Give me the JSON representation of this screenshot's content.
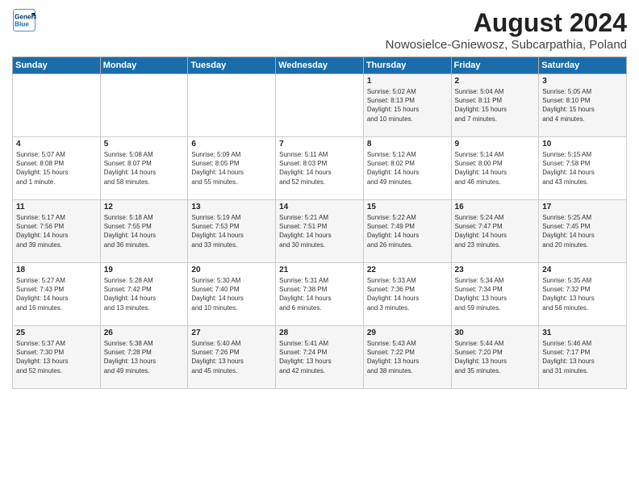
{
  "logo": {
    "line1": "General",
    "line2": "Blue"
  },
  "title": "August 2024",
  "subtitle": "Nowosielce-Gniewosz, Subcarpathia, Poland",
  "days_of_week": [
    "Sunday",
    "Monday",
    "Tuesday",
    "Wednesday",
    "Thursday",
    "Friday",
    "Saturday"
  ],
  "weeks": [
    [
      {
        "day": "",
        "info": ""
      },
      {
        "day": "",
        "info": ""
      },
      {
        "day": "",
        "info": ""
      },
      {
        "day": "",
        "info": ""
      },
      {
        "day": "1",
        "info": "Sunrise: 5:02 AM\nSunset: 8:13 PM\nDaylight: 15 hours\nand 10 minutes."
      },
      {
        "day": "2",
        "info": "Sunrise: 5:04 AM\nSunset: 8:11 PM\nDaylight: 15 hours\nand 7 minutes."
      },
      {
        "day": "3",
        "info": "Sunrise: 5:05 AM\nSunset: 8:10 PM\nDaylight: 15 hours\nand 4 minutes."
      }
    ],
    [
      {
        "day": "4",
        "info": "Sunrise: 5:07 AM\nSunset: 8:08 PM\nDaylight: 15 hours\nand 1 minute."
      },
      {
        "day": "5",
        "info": "Sunrise: 5:08 AM\nSunset: 8:07 PM\nDaylight: 14 hours\nand 58 minutes."
      },
      {
        "day": "6",
        "info": "Sunrise: 5:09 AM\nSunset: 8:05 PM\nDaylight: 14 hours\nand 55 minutes."
      },
      {
        "day": "7",
        "info": "Sunrise: 5:11 AM\nSunset: 8:03 PM\nDaylight: 14 hours\nand 52 minutes."
      },
      {
        "day": "8",
        "info": "Sunrise: 5:12 AM\nSunset: 8:02 PM\nDaylight: 14 hours\nand 49 minutes."
      },
      {
        "day": "9",
        "info": "Sunrise: 5:14 AM\nSunset: 8:00 PM\nDaylight: 14 hours\nand 46 minutes."
      },
      {
        "day": "10",
        "info": "Sunrise: 5:15 AM\nSunset: 7:58 PM\nDaylight: 14 hours\nand 43 minutes."
      }
    ],
    [
      {
        "day": "11",
        "info": "Sunrise: 5:17 AM\nSunset: 7:56 PM\nDaylight: 14 hours\nand 39 minutes."
      },
      {
        "day": "12",
        "info": "Sunrise: 5:18 AM\nSunset: 7:55 PM\nDaylight: 14 hours\nand 36 minutes."
      },
      {
        "day": "13",
        "info": "Sunrise: 5:19 AM\nSunset: 7:53 PM\nDaylight: 14 hours\nand 33 minutes."
      },
      {
        "day": "14",
        "info": "Sunrise: 5:21 AM\nSunset: 7:51 PM\nDaylight: 14 hours\nand 30 minutes."
      },
      {
        "day": "15",
        "info": "Sunrise: 5:22 AM\nSunset: 7:49 PM\nDaylight: 14 hours\nand 26 minutes."
      },
      {
        "day": "16",
        "info": "Sunrise: 5:24 AM\nSunset: 7:47 PM\nDaylight: 14 hours\nand 23 minutes."
      },
      {
        "day": "17",
        "info": "Sunrise: 5:25 AM\nSunset: 7:45 PM\nDaylight: 14 hours\nand 20 minutes."
      }
    ],
    [
      {
        "day": "18",
        "info": "Sunrise: 5:27 AM\nSunset: 7:43 PM\nDaylight: 14 hours\nand 16 minutes."
      },
      {
        "day": "19",
        "info": "Sunrise: 5:28 AM\nSunset: 7:42 PM\nDaylight: 14 hours\nand 13 minutes."
      },
      {
        "day": "20",
        "info": "Sunrise: 5:30 AM\nSunset: 7:40 PM\nDaylight: 14 hours\nand 10 minutes."
      },
      {
        "day": "21",
        "info": "Sunrise: 5:31 AM\nSunset: 7:38 PM\nDaylight: 14 hours\nand 6 minutes."
      },
      {
        "day": "22",
        "info": "Sunrise: 5:33 AM\nSunset: 7:36 PM\nDaylight: 14 hours\nand 3 minutes."
      },
      {
        "day": "23",
        "info": "Sunrise: 5:34 AM\nSunset: 7:34 PM\nDaylight: 13 hours\nand 59 minutes."
      },
      {
        "day": "24",
        "info": "Sunrise: 5:35 AM\nSunset: 7:32 PM\nDaylight: 13 hours\nand 56 minutes."
      }
    ],
    [
      {
        "day": "25",
        "info": "Sunrise: 5:37 AM\nSunset: 7:30 PM\nDaylight: 13 hours\nand 52 minutes."
      },
      {
        "day": "26",
        "info": "Sunrise: 5:38 AM\nSunset: 7:28 PM\nDaylight: 13 hours\nand 49 minutes."
      },
      {
        "day": "27",
        "info": "Sunrise: 5:40 AM\nSunset: 7:26 PM\nDaylight: 13 hours\nand 45 minutes."
      },
      {
        "day": "28",
        "info": "Sunrise: 5:41 AM\nSunset: 7:24 PM\nDaylight: 13 hours\nand 42 minutes."
      },
      {
        "day": "29",
        "info": "Sunrise: 5:43 AM\nSunset: 7:22 PM\nDaylight: 13 hours\nand 38 minutes."
      },
      {
        "day": "30",
        "info": "Sunrise: 5:44 AM\nSunset: 7:20 PM\nDaylight: 13 hours\nand 35 minutes."
      },
      {
        "day": "31",
        "info": "Sunrise: 5:46 AM\nSunset: 7:17 PM\nDaylight: 13 hours\nand 31 minutes."
      }
    ]
  ]
}
